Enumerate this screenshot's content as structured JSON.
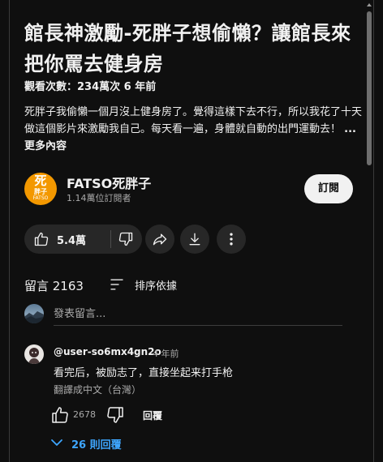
{
  "video": {
    "title": "館長神激勵-死胖子想偷懶？讓館長來把你罵去健身房",
    "views": "觀看次數：234萬次  6 年前",
    "description": "死胖子我偷懶一個月沒上健身房了。覺得這樣下去不行，所以我花了十天做這個影片來激勵我自己。每天看一遍，身體就自動的出門運動去！ ",
    "more_label": "...更多內容"
  },
  "channel": {
    "avatar_line1": "死",
    "avatar_line2": "胖子",
    "avatar_line3": "FATSO",
    "name": "FATSO死胖子",
    "subscribers": "1.14萬位訂閱者",
    "subscribe_label": "訂閱"
  },
  "actions": {
    "like_count": "5.4萬",
    "icons": [
      "thumb-up-icon",
      "thumb-down-icon",
      "share-icon",
      "download-icon",
      "more-vert-icon"
    ]
  },
  "comments": {
    "count_label": "留言 2163",
    "sort_label": "排序依據",
    "add_placeholder": "發表留言...",
    "items": [
      {
        "author": "@user-so6mx4gn2o",
        "time": "4 年前",
        "text": "看完后，被励志了，直接坐起来打手枪",
        "translate_label": "翻譯成中文（台灣）",
        "like_count": "2678",
        "reply_label": "回覆",
        "replies_label": "26 則回覆"
      }
    ]
  },
  "colors": {
    "background": "#0f0f0f",
    "pill": "#272727",
    "accent_link": "#3ea6ff",
    "channel_avatar": "#f39800"
  }
}
